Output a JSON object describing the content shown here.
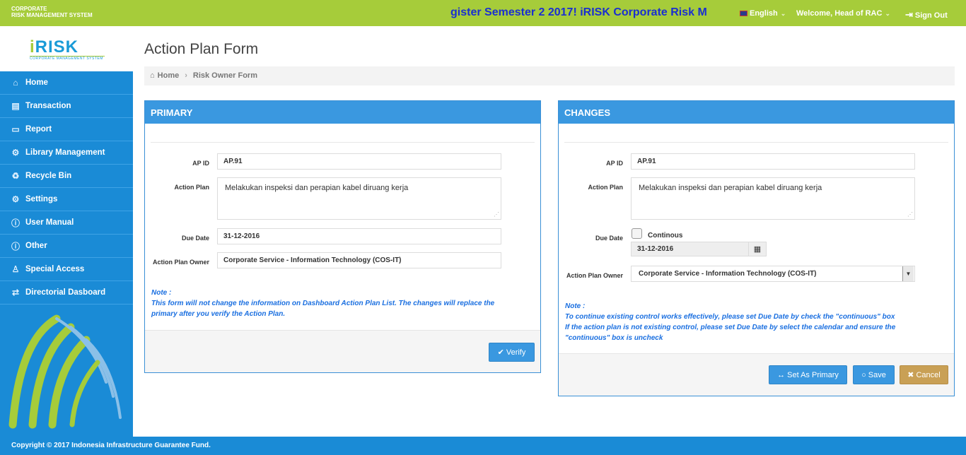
{
  "header": {
    "brand_line1": "CORPORATE",
    "brand_line2": "RISK MANAGEMENT SYSTEM",
    "marquee": "gister Semester 2 2017! iRISK Corporate Risk M",
    "language": "English",
    "welcome": "Welcome, Head of RAC",
    "signout": "Sign Out"
  },
  "logo": {
    "text_a": "i",
    "text_b": "RISK",
    "tagline": "CORPORATE MANAGEMENT SYSTEM"
  },
  "sidebar": {
    "items": [
      {
        "label": "Home",
        "icon": "home-icon"
      },
      {
        "label": "Transaction",
        "icon": "book-icon"
      },
      {
        "label": "Report",
        "icon": "folder-icon"
      },
      {
        "label": "Library Management",
        "icon": "gear-icon"
      },
      {
        "label": "Recycle Bin",
        "icon": "recycle-icon"
      },
      {
        "label": "Settings",
        "icon": "gear-icon"
      },
      {
        "label": "User Manual",
        "icon": "info-icon"
      },
      {
        "label": "Other",
        "icon": "info-icon"
      },
      {
        "label": "Special Access",
        "icon": "user-icon"
      },
      {
        "label": "Directorial Dasboard",
        "icon": "exchange-icon"
      }
    ]
  },
  "page": {
    "title": "Action Plan Form"
  },
  "breadcrumb": {
    "home": "Home",
    "current": "Risk Owner Form"
  },
  "primary": {
    "title": "PRIMARY",
    "ap_id_label": "AP ID",
    "ap_id": "AP.91",
    "action_plan_label": "Action Plan",
    "action_plan": "Melakukan inspeksi dan perapian kabel diruang kerja",
    "due_date_label": "Due Date",
    "due_date": "31-12-2016",
    "owner_label": "Action Plan Owner",
    "owner": "Corporate Service - Information Technology (COS-IT)",
    "note_title": "Note :",
    "note_line1": "This form will not change the information on Dashboard Action Plan List. The changes will replace the",
    "note_line2": "primary after you verify the Action Plan.",
    "verify_label": "Verify"
  },
  "changes": {
    "title": "CHANGES",
    "ap_id_label": "AP ID",
    "ap_id": "AP.91",
    "action_plan_label": "Action Plan",
    "action_plan": "Melakukan inspeksi dan perapian kabel diruang kerja",
    "due_date_label": "Due Date",
    "continous_label": "Continous",
    "continous_checked": false,
    "due_date": "31-12-2016",
    "owner_label": "Action Plan Owner",
    "owner": "Corporate Service - Information Technology (COS-IT)",
    "note_title": "Note :",
    "note_line1": "To continue existing control works effectively, please set Due Date by check the \"continuous\" box",
    "note_line2": "If the action plan is not existing control, please set Due Date by select the calendar and ensure the",
    "note_line3": "\"continuous\" box is uncheck",
    "set_primary_label": "Set As Primary",
    "save_label": "Save",
    "cancel_label": "Cancel"
  },
  "footer": {
    "copyright": "Copyright © 2017 Indonesia Infrastructure Guarantee Fund."
  },
  "colors": {
    "topbar": "#a6cc3a",
    "sidebar": "#1a8bd6",
    "panel_header": "#3a98e0",
    "cancel": "#c9a055",
    "note": "#1a6fe0"
  }
}
